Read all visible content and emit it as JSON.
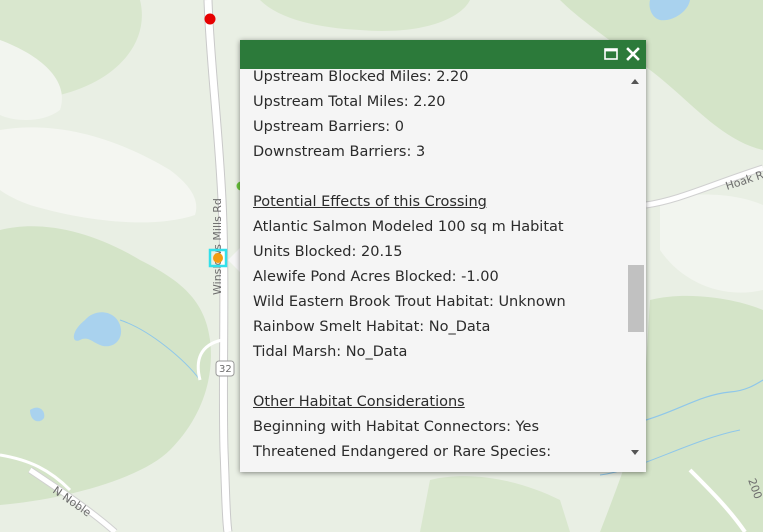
{
  "map": {
    "roads": [
      {
        "id": "winslows-mills-rd",
        "label": "Winslows Mills Rd"
      },
      {
        "id": "hoak-rd",
        "label": "Hoak R"
      },
      {
        "id": "n-nobleboro-rd",
        "label": "N Noble"
      },
      {
        "id": "route-32",
        "label": "32"
      },
      {
        "id": "route-200",
        "label": "200"
      }
    ],
    "colors": {
      "background": "#e9efe4",
      "forest": "#d7e6cc",
      "road": "#ffffff",
      "water": "#a9d2ee",
      "barrier_red": "#e60000",
      "barrier_green": "#6ac73b",
      "selected_highlight": "#33e0ea",
      "selected_marker": "#f39c12"
    }
  },
  "popup": {
    "colors": {
      "header": "#2c7a3a",
      "body": "#f5f5f5"
    },
    "icons": {
      "maximize": "maximize-icon",
      "close": "close-icon"
    },
    "lines": [
      {
        "type": "text",
        "text": "Upstream Blocked Miles: 2.20"
      },
      {
        "type": "text",
        "text": "Upstream Total Miles: 2.20"
      },
      {
        "type": "text",
        "text": "Upstream Barriers: 0"
      },
      {
        "type": "text",
        "text": "Downstream Barriers: 3"
      },
      {
        "type": "gap",
        "text": ""
      },
      {
        "type": "heading",
        "text": "Potential Effects of this Crossing"
      },
      {
        "type": "text",
        "text": "Atlantic Salmon Modeled 100 sq m Habitat"
      },
      {
        "type": "text",
        "text": "Units Blocked: 20.15"
      },
      {
        "type": "text",
        "text": "Alewife Pond Acres Blocked: -1.00"
      },
      {
        "type": "text",
        "text": "Wild Eastern Brook Trout Habitat: Unknown"
      },
      {
        "type": "text",
        "text": "Rainbow Smelt Habitat: No_Data"
      },
      {
        "type": "text",
        "text": "Tidal Marsh: No_Data"
      },
      {
        "type": "gap",
        "text": ""
      },
      {
        "type": "heading",
        "text": "Other Habitat Considerations"
      },
      {
        "type": "text",
        "text": "Beginning with Habitat Connectors: Yes"
      },
      {
        "type": "text",
        "text": "Threatened Endangered or Rare Species:"
      }
    ]
  }
}
